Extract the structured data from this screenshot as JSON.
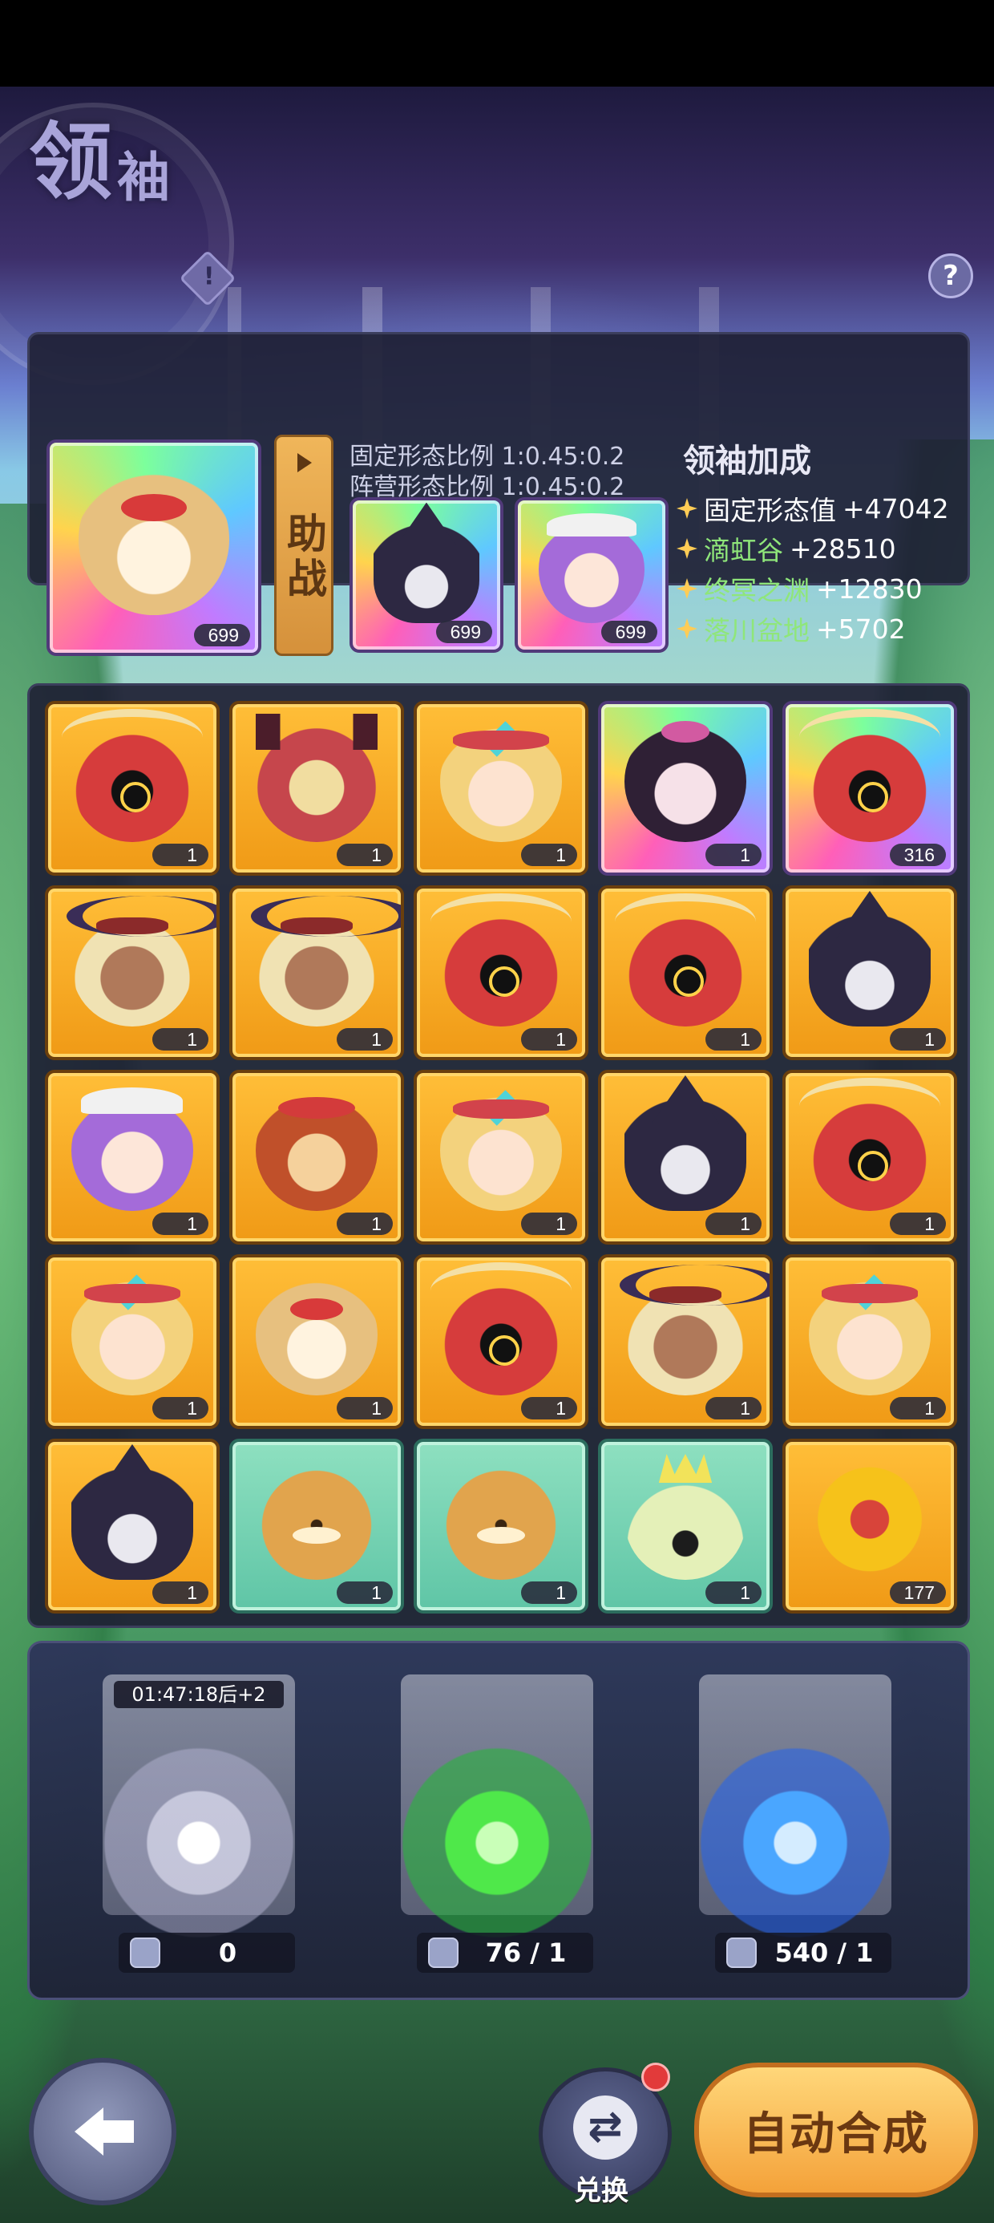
{
  "header": {
    "title_main": "领",
    "title_sub": "袖",
    "info_icon": "!",
    "help_icon": "?"
  },
  "leader": {
    "main": {
      "level": "699",
      "portrait": "fox"
    },
    "assist_label": "助战",
    "fixed_ratio_label": "固定形态比例",
    "fixed_ratio_value": "1:0.45:0.2",
    "camp_ratio_label": "阵营形态比例",
    "camp_ratio_value": "1:0.45:0.2",
    "assists": [
      {
        "level": "699",
        "portrait": "knight"
      },
      {
        "level": "699",
        "portrait": "purple"
      }
    ],
    "bonus_title": "领袖加成",
    "bonuses": [
      {
        "name": "固定形态值",
        "value": "+47042"
      },
      {
        "name": "滴虹谷",
        "value": "+28510"
      },
      {
        "name": "终冥之渊",
        "value": "+12830"
      },
      {
        "name": "落川盆地",
        "value": "+5702"
      }
    ]
  },
  "grid": [
    {
      "portrait": "hood",
      "count": "1",
      "frame": "gold"
    },
    {
      "portrait": "dragon",
      "count": "1",
      "frame": "gold"
    },
    {
      "portrait": "blonde",
      "count": "1",
      "frame": "gold"
    },
    {
      "portrait": "geisha",
      "count": "1",
      "frame": "rainbow"
    },
    {
      "portrait": "hood",
      "count": "316",
      "frame": "rainbow"
    },
    {
      "portrait": "horns",
      "count": "1",
      "frame": "gold"
    },
    {
      "portrait": "horns",
      "count": "1",
      "frame": "gold"
    },
    {
      "portrait": "hood",
      "count": "1",
      "frame": "gold"
    },
    {
      "portrait": "hood",
      "count": "1",
      "frame": "gold"
    },
    {
      "portrait": "knight",
      "count": "1",
      "frame": "gold"
    },
    {
      "portrait": "purple",
      "count": "1",
      "frame": "gold"
    },
    {
      "portrait": "lion",
      "count": "1",
      "frame": "gold"
    },
    {
      "portrait": "blonde",
      "count": "1",
      "frame": "gold"
    },
    {
      "portrait": "knight",
      "count": "1",
      "frame": "gold"
    },
    {
      "portrait": "hood",
      "count": "1",
      "frame": "gold"
    },
    {
      "portrait": "blonde",
      "count": "1",
      "frame": "gold"
    },
    {
      "portrait": "fox",
      "count": "1",
      "frame": "gold"
    },
    {
      "portrait": "hood",
      "count": "1",
      "frame": "gold"
    },
    {
      "portrait": "horns",
      "count": "1",
      "frame": "gold"
    },
    {
      "portrait": "blonde",
      "count": "1",
      "frame": "gold"
    },
    {
      "portrait": "knight",
      "count": "1",
      "frame": "gold"
    },
    {
      "portrait": "tiger",
      "count": "1",
      "frame": "teal"
    },
    {
      "portrait": "tiger",
      "count": "1",
      "frame": "teal"
    },
    {
      "portrait": "bell",
      "count": "1",
      "frame": "teal"
    },
    {
      "portrait": "flower",
      "count": "177",
      "frame": "gold"
    }
  ],
  "summon": {
    "pools": [
      {
        "color": "white",
        "timer": "01:47:18后+2",
        "count": "0"
      },
      {
        "color": "green",
        "count": "76 / 1"
      },
      {
        "color": "blue",
        "count": "540 / 1"
      }
    ]
  },
  "footer": {
    "swap_label": "兑换",
    "auto_label": "自动合成"
  }
}
